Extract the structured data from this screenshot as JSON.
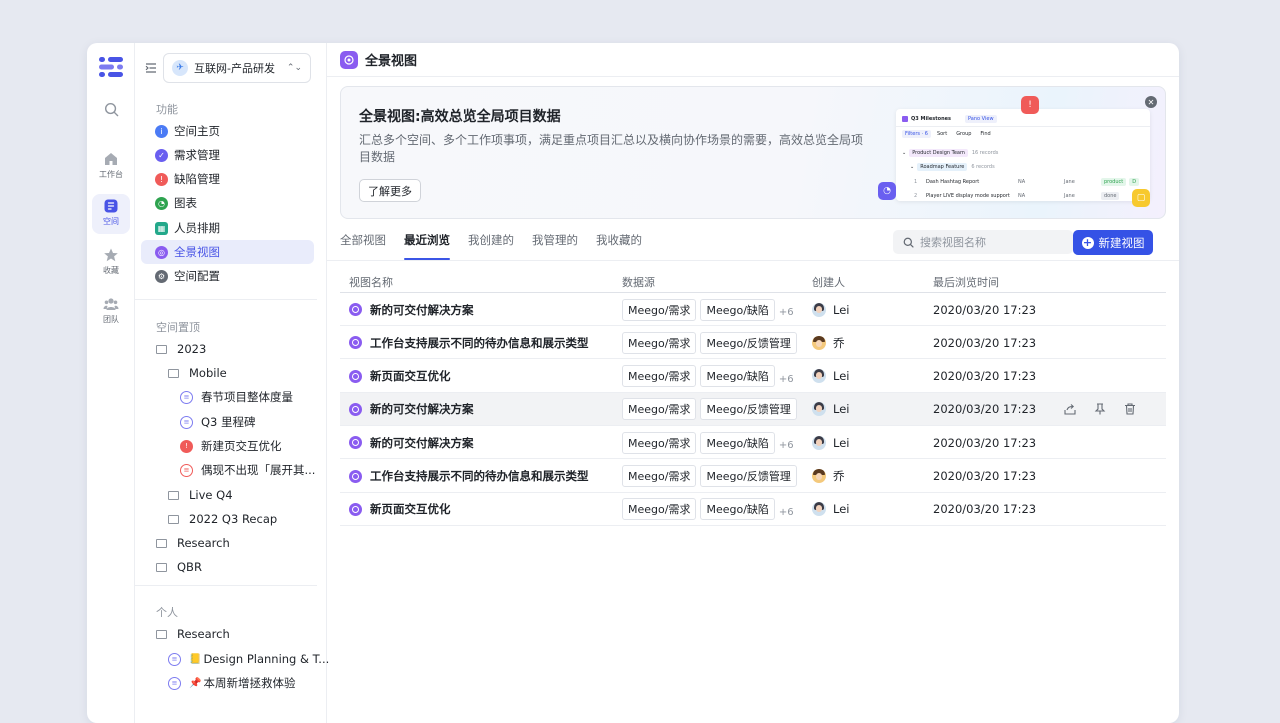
{
  "rail": {
    "items": [
      {
        "label": "",
        "icon": "search-icon"
      },
      {
        "label": "工作台",
        "icon": "home-icon"
      },
      {
        "label": "空间",
        "icon": "space-icon"
      },
      {
        "label": "收藏",
        "icon": "star-icon"
      },
      {
        "label": "团队",
        "icon": "team-icon"
      }
    ]
  },
  "sidebar": {
    "workspace": "互联网-产品研发",
    "functions_label": "功能",
    "nav": [
      {
        "label": "空间主页",
        "color": "#4b7bf5",
        "glyph": "i"
      },
      {
        "label": "需求管理",
        "color": "#6a5ff0",
        "glyph": "✓"
      },
      {
        "label": "缺陷管理",
        "color": "#f05b59",
        "glyph": "!"
      },
      {
        "label": "图表",
        "color": "#2ea34f",
        "glyph": "◔"
      },
      {
        "label": "人员排期",
        "color": "#23a88a",
        "glyph": "▦"
      },
      {
        "label": "全景视图",
        "color": "#8a5cf0",
        "glyph": "◎"
      },
      {
        "label": "空间配置",
        "color": "#646a73",
        "glyph": "⚙"
      }
    ],
    "pinned_label": "空间置顶",
    "pinned": [
      {
        "label": "2023"
      },
      {
        "label": "Mobile"
      },
      {
        "label": "春节项目整体度量"
      },
      {
        "label": "Q3 里程碑"
      },
      {
        "label": "新建页交互优化"
      },
      {
        "label": "偶现不出现「展开其..."
      },
      {
        "label": "Live Q4"
      },
      {
        "label": "2022 Q3 Recap"
      },
      {
        "label": "Research"
      },
      {
        "label": "QBR"
      }
    ],
    "personal_label": "个人",
    "personal": [
      {
        "label": "Research"
      },
      {
        "label": "Design Planning & T..."
      },
      {
        "label": "本周新增拯救体验"
      }
    ]
  },
  "main": {
    "title": "全景视图",
    "banner": {
      "title": "全景视图:高效总览全局项目数据",
      "desc": "汇总多个空间、多个工作项事项，满足重点项目汇总以及横向协作场景的需要，高效总览全局项目数据",
      "button": "了解更多",
      "preview": {
        "title": "Q3 Milestones",
        "view": "Pano View",
        "toolbar": [
          "Filters · 6",
          "Sort",
          "Group",
          "Find"
        ],
        "group": "Product Design Team",
        "group_count": "16 records",
        "subgroup": "Roadmap Feature",
        "subgroup_count": "6 records",
        "rows": [
          {
            "num": "1",
            "name": "Dash Hashtag Report",
            "col": "NA",
            "user": "Jane",
            "tag": "product",
            "extra": "D"
          },
          {
            "num": "2",
            "name": "Player LIVE display mode support",
            "col": "NA",
            "user": "Jane",
            "tag": "done",
            "extra": ""
          }
        ]
      }
    },
    "tabs": [
      "全部视图",
      "最近浏览",
      "我创建的",
      "我管理的",
      "我收藏的"
    ],
    "active_tab": "最近浏览",
    "search_placeholder": "搜索视图名称",
    "new_button": "新建视图",
    "table": {
      "headers": [
        "视图名称",
        "数据源",
        "创建人",
        "最后浏览时间"
      ],
      "rows": [
        {
          "name": "新的可交付解决方案",
          "sources": [
            "Meego/需求",
            "Meego/缺陷"
          ],
          "more": "+6",
          "creator": "Lei",
          "avatar": "lei",
          "time": "2020/03/20 17:23"
        },
        {
          "name": "工作台支持展示不同的待办信息和展示类型",
          "sources": [
            "Meego/需求",
            "Meego/反馈管理"
          ],
          "more": "",
          "creator": "乔",
          "avatar": "qiao",
          "time": "2020/03/20 17:23"
        },
        {
          "name": "新页面交互优化",
          "sources": [
            "Meego/需求",
            "Meego/缺陷"
          ],
          "more": "+6",
          "creator": "Lei",
          "avatar": "lei",
          "time": "2020/03/20 17:23"
        },
        {
          "name": "新的可交付解决方案",
          "sources": [
            "Meego/需求",
            "Meego/反馈管理"
          ],
          "more": "",
          "creator": "Lei",
          "avatar": "lei",
          "time": "2020/03/20 17:23"
        },
        {
          "name": "新的可交付解决方案",
          "sources": [
            "Meego/需求",
            "Meego/缺陷"
          ],
          "more": "+6",
          "creator": "Lei",
          "avatar": "lei",
          "time": "2020/03/20 17:23"
        },
        {
          "name": "工作台支持展示不同的待办信息和展示类型",
          "sources": [
            "Meego/需求",
            "Meego/反馈管理"
          ],
          "more": "",
          "creator": "乔",
          "avatar": "qiao",
          "time": "2020/03/20 17:23"
        },
        {
          "name": "新页面交互优化",
          "sources": [
            "Meego/需求",
            "Meego/缺陷"
          ],
          "more": "+6",
          "creator": "Lei",
          "avatar": "lei",
          "time": "2020/03/20 17:23"
        }
      ]
    }
  },
  "colors": {
    "accent": "#3552e6",
    "purple": "#8a5cf0",
    "active_bg": "#e9ecfb"
  }
}
